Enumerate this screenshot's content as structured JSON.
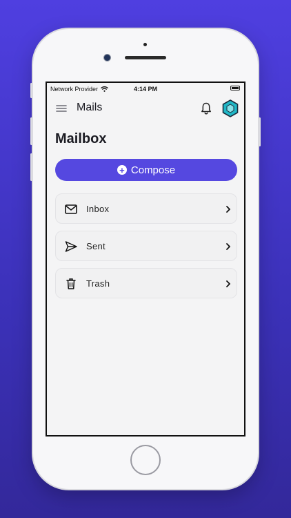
{
  "statusbar": {
    "carrier": "Network Provider",
    "time": "4:14 PM"
  },
  "appbar": {
    "title": "Mails",
    "menu_icon": "hamburger-menu-icon",
    "notification_icon": "bell-icon",
    "profile_icon": "hexagon-logo-icon"
  },
  "page": {
    "title": "Mailbox"
  },
  "compose": {
    "label": "Compose",
    "icon": "plus-circle-icon"
  },
  "folders": [
    {
      "label": "Inbox",
      "icon": "envelope-icon"
    },
    {
      "label": "Sent",
      "icon": "paper-plane-icon"
    },
    {
      "label": "Trash",
      "icon": "trash-icon"
    }
  ],
  "colors": {
    "accent": "#5548e0",
    "background": "#4f3fe0",
    "logo": "#1fb7c6"
  }
}
